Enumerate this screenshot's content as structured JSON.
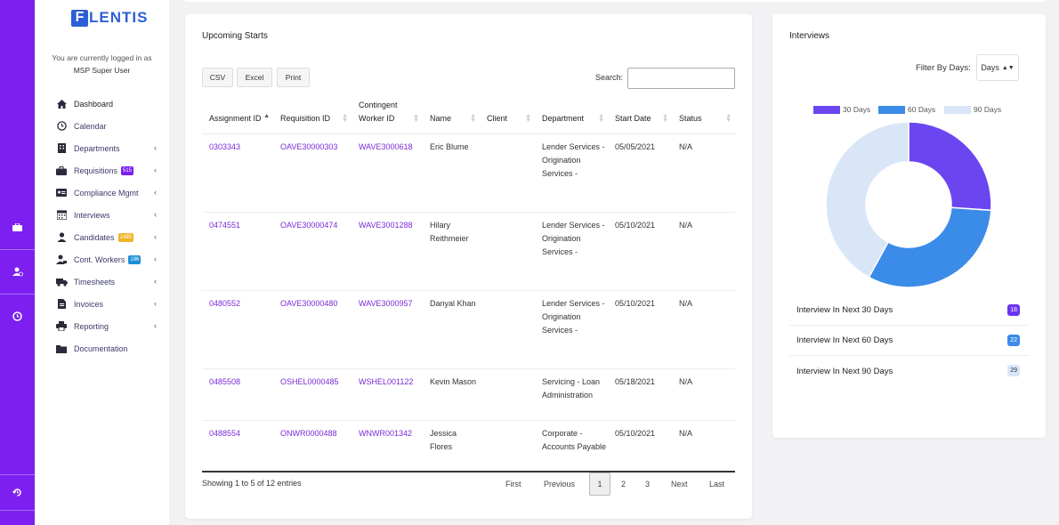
{
  "brand": {
    "logo_letter": "F",
    "logo_text": "LENTIS",
    "color": "#2d5fd6"
  },
  "session": {
    "logged_in_text": "You are currently logged in as",
    "user": "MSP Super User"
  },
  "rail_icons": [
    "briefcase-icon",
    "user-clock-icon",
    "clock-icon",
    "history-icon"
  ],
  "sidebar": {
    "items": [
      {
        "label": "Dashboard",
        "icon": "home-icon",
        "chevron": false,
        "badge": ""
      },
      {
        "label": "Calendar",
        "icon": "calendar-icon",
        "chevron": false,
        "badge": ""
      },
      {
        "label": "Departments",
        "icon": "building-icon",
        "chevron": true,
        "badge": ""
      },
      {
        "label": "Requisitions",
        "icon": "briefcase-icon",
        "chevron": true,
        "badge": "515",
        "badge_color": "#7c1ff0"
      },
      {
        "label": "Compliance Mgmt",
        "icon": "id-card-icon",
        "chevron": true,
        "badge": ""
      },
      {
        "label": "Interviews",
        "icon": "calendar-grid-icon",
        "chevron": true,
        "badge": ""
      },
      {
        "label": "Candidates",
        "icon": "user-icon",
        "chevron": true,
        "badge": "1495",
        "badge_color": "#f0b429"
      },
      {
        "label": "Cont. Workers",
        "icon": "user-tie-icon",
        "chevron": true,
        "badge": "196",
        "badge_color": "#1f8fd6"
      },
      {
        "label": "Timesheets",
        "icon": "truck-icon",
        "chevron": true,
        "badge": ""
      },
      {
        "label": "Invoices",
        "icon": "invoice-icon",
        "chevron": true,
        "badge": ""
      },
      {
        "label": "Reporting",
        "icon": "printer-icon",
        "chevron": true,
        "badge": ""
      },
      {
        "label": "Documentation",
        "icon": "folder-icon",
        "chevron": false,
        "badge": ""
      }
    ]
  },
  "upcoming": {
    "title": "Upcoming Starts",
    "buttons": [
      "CSV",
      "Excel",
      "Print"
    ],
    "search_label": "Search:",
    "search_value": "",
    "columns": [
      "Assignment ID",
      "Requisition ID",
      "Contingent Worker ID",
      "Name",
      "Client",
      "Department",
      "Start Date",
      "Status"
    ],
    "rows": [
      {
        "assignment": "0303343",
        "requisition": "OAVE30000303",
        "worker": "WAVE3000618",
        "name": "Eric Blume",
        "client": "",
        "department": "Lender Services - Origination Services -",
        "start": "05/05/2021",
        "status": "N/A"
      },
      {
        "assignment": "0474551",
        "requisition": "OAVE30000474",
        "worker": "WAVE3001288",
        "name": "Hilary Reithmeier",
        "client": "",
        "department": "Lender Services - Origination Services -",
        "start": "05/10/2021",
        "status": "N/A"
      },
      {
        "assignment": "0480552",
        "requisition": "OAVE30000480",
        "worker": "WAVE3000957",
        "name": "Danyal Khan",
        "client": "",
        "department": "Lender Services - Origination Services -",
        "start": "05/10/2021",
        "status": "N/A"
      },
      {
        "assignment": "0485508",
        "requisition": "OSHEL0000485",
        "worker": "WSHEL001122",
        "name": "Kevin Mason",
        "client": "",
        "department": "Servicing - Loan Administration",
        "start": "05/18/2021",
        "status": "N/A"
      },
      {
        "assignment": "0488554",
        "requisition": "ONWR0000488",
        "worker": "WNWR001342",
        "name": "Jessica Flores",
        "client": "",
        "department": "Corporate - Accounts Payable",
        "start": "05/10/2021",
        "status": "N/A"
      }
    ],
    "info": "Showing 1 to 5 of 12 entries",
    "pager": {
      "first": "First",
      "previous": "Previous",
      "pages": [
        "1",
        "2",
        "3"
      ],
      "current": "1",
      "next": "Next",
      "last": "Last"
    }
  },
  "interviews": {
    "title": "Interviews",
    "filter_label": "Filter By Days:",
    "filter_value": "Days",
    "stats": [
      {
        "label": "Interview In Next 30 Days",
        "count": "18",
        "bg": "#6a35f0",
        "fg": "#ffffff"
      },
      {
        "label": "Interview In Next 60 Days",
        "count": "22",
        "bg": "#3b8be8",
        "fg": "#ffffff"
      },
      {
        "label": "Interview In Next 90 Days",
        "count": "29",
        "bg": "#d8e6f7",
        "fg": "#333333"
      }
    ]
  },
  "chart_data": {
    "type": "pie",
    "categories": [
      "30 Days",
      "60 Days",
      "90 Days"
    ],
    "values": [
      18,
      22,
      29
    ],
    "colors": [
      "#6a45f0",
      "#3b8be8",
      "#d8e6f7"
    ],
    "title": "",
    "legend": "top"
  }
}
